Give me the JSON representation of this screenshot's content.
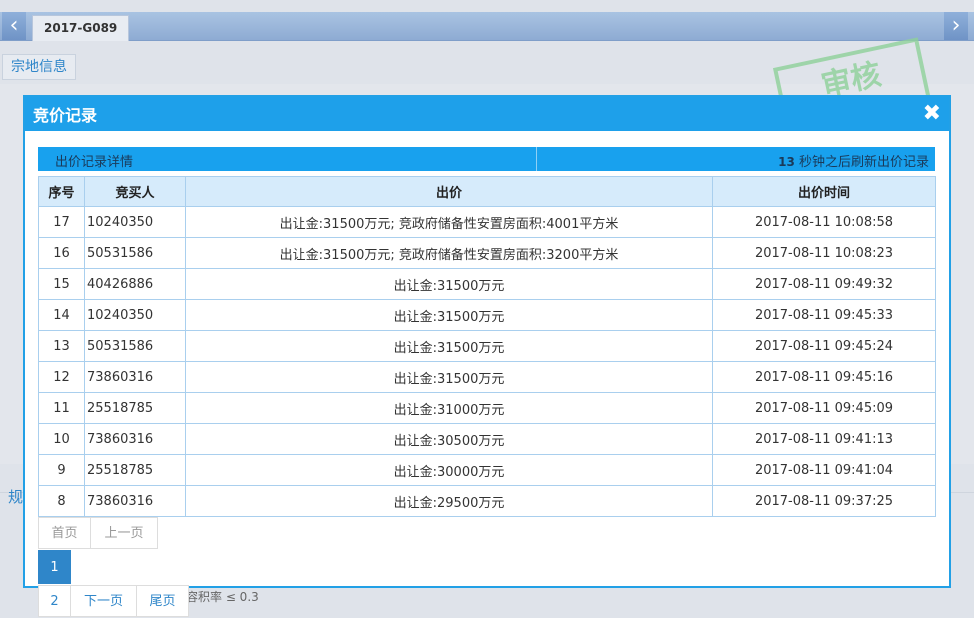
{
  "page": {
    "tab_label": "2017-G089",
    "nav_left_icon": "‹",
    "nav_right_icon": "›",
    "bg_button": "宗地信息",
    "bg_fragment": "规",
    "bg_text": "容积率 ≤ 0.3",
    "stamp_text": "审核"
  },
  "dialog": {
    "title": "竞价记录",
    "close_icon": "✖",
    "info_label": "出价记录详情",
    "countdown_number": "13",
    "countdown_text": "秒钟之后刷新出价记录"
  },
  "table": {
    "headers": [
      "序号",
      "竞买人",
      "出价",
      "出价时间"
    ],
    "rows": [
      {
        "no": "17",
        "bidder": "10240350",
        "bid": "出让金:31500万元; 竞政府储备性安置房面积:4001平方米",
        "time": "2017-08-11 10:08:58"
      },
      {
        "no": "16",
        "bidder": "50531586",
        "bid": "出让金:31500万元; 竞政府储备性安置房面积:3200平方米",
        "time": "2017-08-11 10:08:23"
      },
      {
        "no": "15",
        "bidder": "40426886",
        "bid": "出让金:31500万元",
        "time": "2017-08-11 09:49:32"
      },
      {
        "no": "14",
        "bidder": "10240350",
        "bid": "出让金:31500万元",
        "time": "2017-08-11 09:45:33"
      },
      {
        "no": "13",
        "bidder": "50531586",
        "bid": "出让金:31500万元",
        "time": "2017-08-11 09:45:24"
      },
      {
        "no": "12",
        "bidder": "73860316",
        "bid": "出让金:31500万元",
        "time": "2017-08-11 09:45:16"
      },
      {
        "no": "11",
        "bidder": "25518785",
        "bid": "出让金:31000万元",
        "time": "2017-08-11 09:45:09"
      },
      {
        "no": "10",
        "bidder": "73860316",
        "bid": "出让金:30500万元",
        "time": "2017-08-11 09:41:13"
      },
      {
        "no": "9",
        "bidder": "25518785",
        "bid": "出让金:30000万元",
        "time": "2017-08-11 09:41:04"
      },
      {
        "no": "8",
        "bidder": "73860316",
        "bid": "出让金:29500万元",
        "time": "2017-08-11 09:37:25"
      }
    ]
  },
  "pager": {
    "first": "首页",
    "prev": "上一页",
    "current": "1",
    "page2": "2",
    "next": "下一页",
    "last": "尾页"
  }
}
